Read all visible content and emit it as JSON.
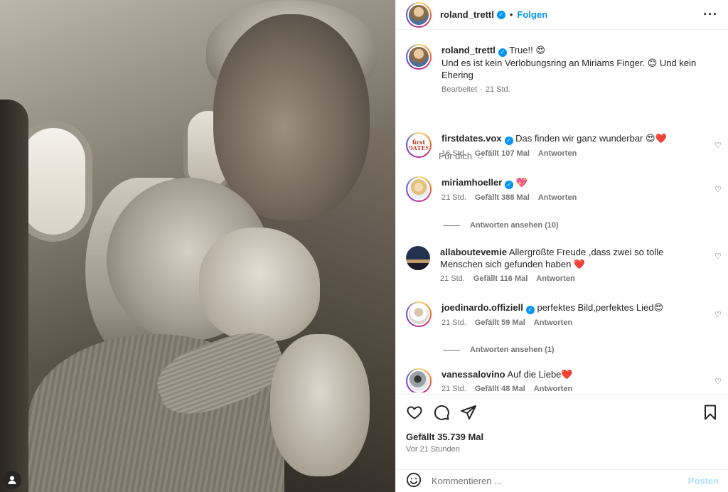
{
  "post": {
    "username": "roland_trettl",
    "follow_label": "Folgen",
    "dot": "•",
    "caption_line1": "True!! 😍",
    "caption_line2": "Und es ist kein Verlobungsring an Miriams Finger. 😊 Und kein Ehering",
    "caption_edited": "Bearbeitet",
    "caption_time": "21 Std.",
    "for_you_label": "Für dich",
    "likes": "Gefällt 35.739 Mal",
    "posted_ago": "Vor 21 Stunden"
  },
  "comments": [
    {
      "user": "firstdates.vox",
      "verified": true,
      "text": "Das finden wir ganz wunderbar 😍❤️",
      "time": "16 Std.",
      "likes": "Gefällt 107 Mal",
      "reply": "Antworten",
      "avatar": "first-dates-logo",
      "avatar_text": "first DATES"
    },
    {
      "user": "miriamhoeller",
      "verified": true,
      "text": "💖",
      "time": "21 Std.",
      "likes": "Gefällt 388 Mal",
      "reply": "Antworten",
      "avatar": "miriam-avatar",
      "view_replies": "Antworten ansehen (10)"
    },
    {
      "user": "allaboutevemie",
      "verified": false,
      "text": "Allergrößte Freude ,dass zwei so tolle Menschen sich gefunden haben ❤️",
      "time": "21 Std.",
      "likes": "Gefällt 116 Mal",
      "reply": "Antworten",
      "avatar": "landscape-avatar"
    },
    {
      "user": "joedinardo.offiziell",
      "verified": true,
      "text": "perfektes Bild,perfektes Lied😍",
      "time": "21 Std.",
      "likes": "Gefällt 59 Mal",
      "reply": "Antworten",
      "avatar": "joe-avatar",
      "view_replies": "Antworten ansehen (1)"
    },
    {
      "user": "vanessalovino",
      "verified": false,
      "text": "Auf die Liebe❤️",
      "time": "21 Std.",
      "likes": "Gefällt 48 Mal",
      "reply": "Antworten",
      "avatar": "vanessa-avatar"
    }
  ],
  "comment_box": {
    "placeholder": "Kommentieren ...",
    "post_label": "Posten"
  },
  "icons": {
    "heart": "heart-icon",
    "comment": "comment-icon",
    "share": "share-icon",
    "save": "bookmark-icon",
    "emoji": "emoji-icon",
    "more": "more-options-icon",
    "chevron": "chevron-down-icon",
    "user": "user-profile-icon"
  },
  "colors": {
    "accent": "#0095f6",
    "muted": "#737373",
    "post_disabled": "#b2dffc"
  }
}
